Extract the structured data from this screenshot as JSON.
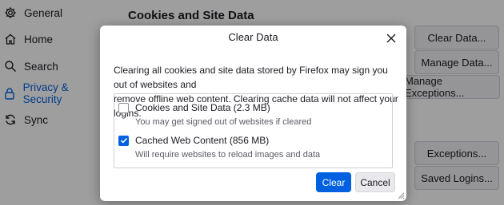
{
  "sidebar": {
    "items": [
      {
        "label": "General",
        "icon": "gear-icon"
      },
      {
        "label": "Home",
        "icon": "home-icon"
      },
      {
        "label": "Search",
        "icon": "search-icon"
      },
      {
        "label": "Privacy & Security",
        "icon": "lock-icon",
        "active": true
      },
      {
        "label": "Sync",
        "icon": "sync-icon"
      }
    ]
  },
  "main": {
    "section_title": "Cookies and Site Data",
    "buttons": {
      "clear_data": "Clear Data...",
      "manage_data": "Manage Data...",
      "manage_exceptions": "Manage Exceptions...",
      "exceptions": "Exceptions...",
      "saved_logins": "Saved Logins..."
    }
  },
  "dialog": {
    "title": "Clear Data",
    "description_line1": "Clearing all cookies and site data stored by Firefox may sign you out of websites and",
    "description_line2": "remove offline web content. Clearing cache data will not affect your logins.",
    "options": [
      {
        "label": "Cookies and Site Data (2.3 MB)",
        "sub": "You may get signed out of websites if cleared",
        "checked": false
      },
      {
        "label": "Cached Web Content (856 MB)",
        "sub": "Will require websites to reload images and data",
        "checked": true
      }
    ],
    "clear_label": "Clear",
    "cancel_label": "Cancel"
  },
  "colors": {
    "accent": "#0061e0",
    "overlay": "rgba(0,0,0,0.38)"
  }
}
